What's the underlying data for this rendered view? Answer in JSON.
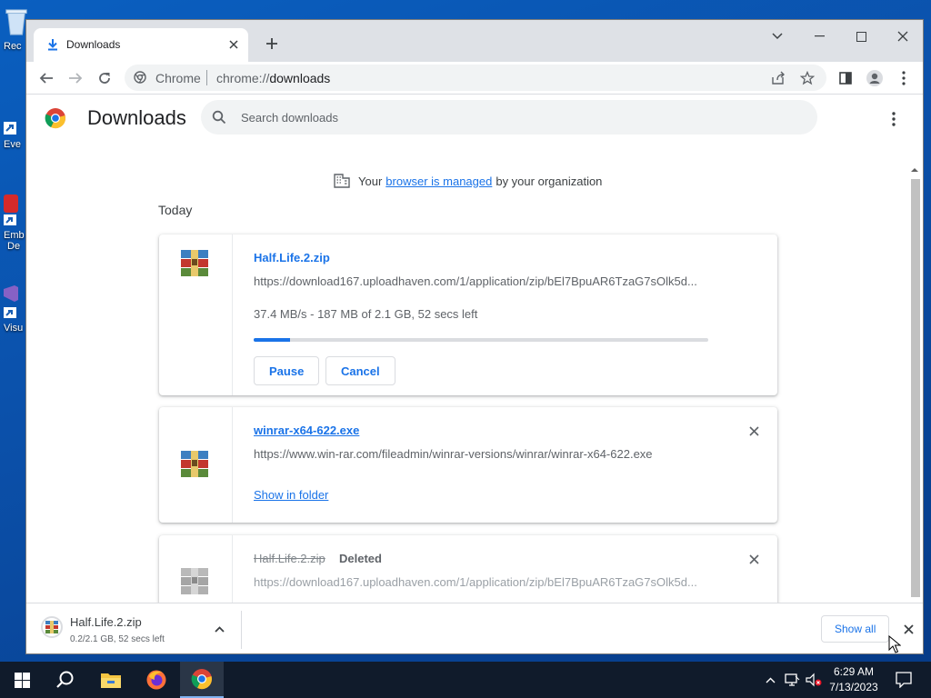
{
  "desktop": {
    "icons": [
      {
        "label": "Rec"
      },
      {
        "label": "Eve"
      },
      {
        "label": "Emb"
      },
      {
        "label": "De"
      },
      {
        "label": "Visu"
      }
    ]
  },
  "browser": {
    "tab": {
      "title": "Downloads",
      "icon": "download-icon",
      "close": "close-icon"
    },
    "new_tab": "plus-icon",
    "window_controls": [
      "tab-search-icon",
      "minimize-icon",
      "maximize-icon",
      "close-icon"
    ],
    "toolbar": {
      "omnibox": {
        "chip": "Chrome",
        "url_scheme": "chrome://",
        "url_path": "downloads"
      }
    }
  },
  "downloads_page": {
    "title": "Downloads",
    "search": {
      "placeholder": "Search downloads",
      "value": ""
    },
    "managed_notice": {
      "before": "Your",
      "link": "browser is managed",
      "after": "by your organization"
    },
    "section_label": "Today",
    "items": [
      {
        "name": "Half.Life.2.zip",
        "url": "https://download167.uploadhaven.com/1/application/zip/bEl7BpuAR6TzaG7sOlk5d...",
        "status": "37.4 MB/s - 187 MB of 2.1 GB, 52 secs left",
        "progress": 0.08,
        "actions": [
          "Pause",
          "Cancel"
        ]
      },
      {
        "name": "winrar-x64-622.exe",
        "url": "https://www.win-rar.com/fileadmin/winrar-versions/winrar/winrar-x64-622.exe",
        "link_action": "Show in folder"
      },
      {
        "name": "Half.Life.2.zip",
        "tag": "Deleted",
        "url": "https://download167.uploadhaven.com/1/application/zip/bEl7BpuAR6TzaG7sOlk5d..."
      }
    ]
  },
  "download_shelf": {
    "item_name": "Half.Life.2.zip",
    "item_status": "0.2/2.1 GB, 52 secs left",
    "show_all": "Show all"
  },
  "taskbar": {
    "time": "6:29 AM",
    "date": "7/13/2023",
    "apps": [
      "windows-start-icon",
      "search-icon",
      "file-explorer-icon",
      "firefox-icon",
      "chrome-icon"
    ]
  },
  "colors": {
    "accent": "#1a73e8",
    "desktop": "#0b4fa8",
    "taskbar": "#101b2b"
  }
}
